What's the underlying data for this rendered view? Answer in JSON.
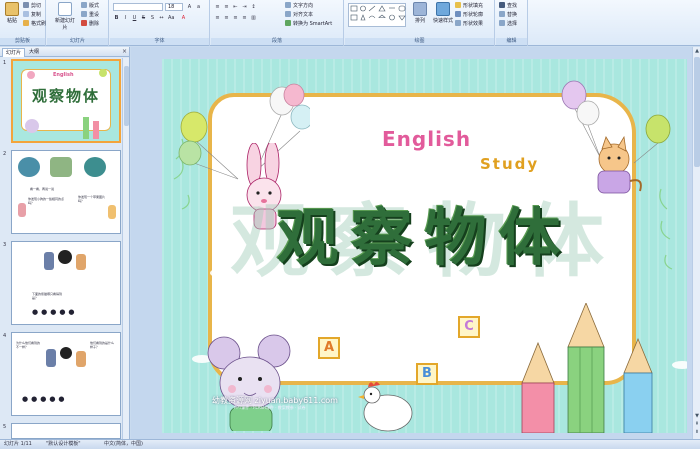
{
  "ribbon": {
    "clipboard": {
      "label": "剪贴板",
      "paste": "粘贴",
      "cut": "剪切",
      "copy": "复制",
      "format_painter": "格式刷"
    },
    "slides": {
      "label": "幻灯片",
      "new_slide": "新建幻灯片",
      "layout": "版式",
      "reset": "重设",
      "delete": "删除"
    },
    "font": {
      "label": "字体",
      "font_name": "",
      "font_size": "18"
    },
    "paragraph": {
      "label": "段落",
      "text_direction": "文字方向",
      "align_text": "对齐文本",
      "smartart": "转换为 SmartArt"
    },
    "drawing": {
      "label": "绘图",
      "arrange": "排列",
      "quick_styles": "快速样式",
      "shape_fill": "形状填充",
      "shape_outline": "形状轮廓",
      "shape_effects": "形状效果"
    },
    "editing": {
      "label": "编辑",
      "find": "查找",
      "replace": "替换",
      "select": "选择"
    }
  },
  "left_pane": {
    "tab_slides": "幻灯片",
    "tab_outline": "大纲",
    "close": "×",
    "slide_numbers": [
      "1",
      "2",
      "3",
      "4",
      "5"
    ],
    "slide2_bubble_left": "看一看，再说一说",
    "slide2_bubble_mid": "你发现小狗的一些相同的点吗？",
    "slide2_bubble_right": "你发现一个苹果图片吗？",
    "slide3_bubble": "下面的熊猫哪只看得到是？",
    "slide4_bubble_left": "为什么他们看到的不一样？",
    "slide4_bubble_right": "他们看到的是什么样子？"
  },
  "slide": {
    "title": "观察物体",
    "english_line1": "English",
    "english_line2": "Study",
    "block_a": "A",
    "block_b": "B",
    "block_c": "C",
    "watermark": "幼教资源网 ziyuan.baby611.com",
    "watermark_sub": "PPT课件 · FLASH课件 · 教案教参 · 试卷"
  },
  "status_bar": {
    "slide_counter": "幻灯片 1/11",
    "theme": "\"默认设计模板\"",
    "language": "中文(简体，中国)"
  },
  "colors": {
    "frame_border": "#e8b54a",
    "title_green": "#2f6e3a",
    "slide_bg": "#a9e7df",
    "selected_thumb": "#f3a43b"
  }
}
